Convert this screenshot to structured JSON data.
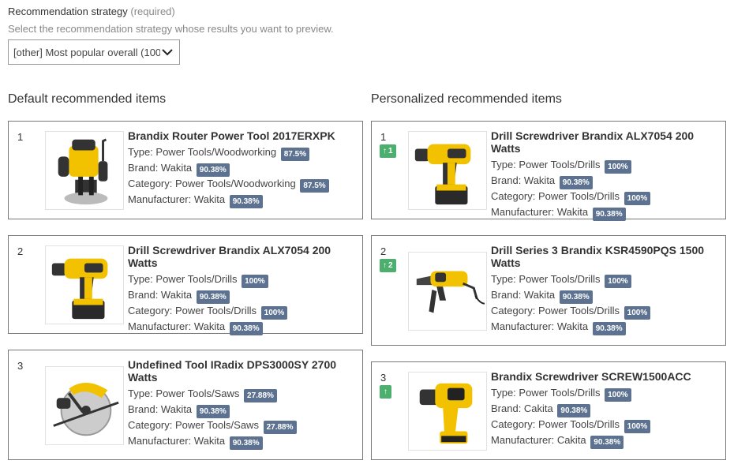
{
  "strategy": {
    "label": "Recommendation strategy",
    "required": "(required)",
    "help": "Select the recommendation strategy whose results you want to preview.",
    "selected": "[other] Most popular overall (100"
  },
  "default_column": {
    "title": "Default recommended items",
    "items": [
      {
        "rank": "1",
        "title": "Brandix Router Power Tool 2017ERXPK",
        "image": "router-image",
        "attrs": [
          {
            "text": "Type: Power Tools/Woodworking",
            "score": "87.5%"
          },
          {
            "text": "Brand: Wakita",
            "score": "90.38%"
          },
          {
            "text": "Category: Power Tools/Woodworking",
            "score": "87.5%"
          },
          {
            "text": "Manufacturer: Wakita",
            "score": "90.38%"
          }
        ]
      },
      {
        "rank": "2",
        "title": "Drill Screwdriver Brandix ALX7054 200 Watts",
        "image": "drill-image",
        "attrs": [
          {
            "text": "Type: Power Tools/Drills",
            "score": "100%"
          },
          {
            "text": "Brand: Wakita",
            "score": "90.38%"
          },
          {
            "text": "Category: Power Tools/Drills",
            "score": "100%"
          },
          {
            "text": "Manufacturer: Wakita",
            "score": "90.38%"
          }
        ]
      },
      {
        "rank": "3",
        "title": "Undefined Tool IRadix DPS3000SY 2700 Watts",
        "image": "circular-saw-image",
        "attrs": [
          {
            "text": "Type: Power Tools/Saws",
            "score": "27.88%"
          },
          {
            "text": "Brand: Wakita",
            "score": "90.38%"
          },
          {
            "text": "Category: Power Tools/Saws",
            "score": "27.88%"
          },
          {
            "text": "Manufacturer: Wakita",
            "score": "90.38%"
          }
        ]
      }
    ]
  },
  "personalized_column": {
    "title": "Personalized recommended items",
    "items": [
      {
        "rank": "1",
        "movement": "1",
        "movement_icon": "arrow-up-icon",
        "title": "Drill Screwdriver Brandix ALX7054 200 Watts",
        "image": "drill-image",
        "attrs": [
          {
            "text": "Type: Power Tools/Drills",
            "score": "100%"
          },
          {
            "text": "Brand: Wakita",
            "score": "90.38%"
          },
          {
            "text": "Category: Power Tools/Drills",
            "score": "100%"
          },
          {
            "text": "Manufacturer: Wakita",
            "score": "90.38%"
          }
        ]
      },
      {
        "rank": "2",
        "movement": "2",
        "movement_icon": "arrow-up-icon",
        "title": "Drill Series 3 Brandix KSR4590PQS 1500 Watts",
        "image": "hammer-drill-image",
        "attrs": [
          {
            "text": "Type: Power Tools/Drills",
            "score": "100%"
          },
          {
            "text": "Brand: Wakita",
            "score": "90.38%"
          },
          {
            "text": "Category: Power Tools/Drills",
            "score": "100%"
          },
          {
            "text": "Manufacturer: Wakita",
            "score": "90.38%"
          }
        ]
      },
      {
        "rank": "3",
        "movement": "",
        "movement_icon": "arrow-up-icon",
        "title": "Brandix Screwdriver SCREW1500ACC",
        "image": "screwdriver-image",
        "attrs": [
          {
            "text": "Type: Power Tools/Drills",
            "score": "100%"
          },
          {
            "text": "Brand: Cakita",
            "score": "90.38%"
          },
          {
            "text": "Category: Power Tools/Drills",
            "score": "100%"
          },
          {
            "text": "Manufacturer: Cakita",
            "score": "90.38%"
          }
        ]
      }
    ]
  },
  "colors": {
    "score_badge": "#5d7290",
    "movement_badge": "#4caf6e",
    "card_border": "#777777"
  }
}
